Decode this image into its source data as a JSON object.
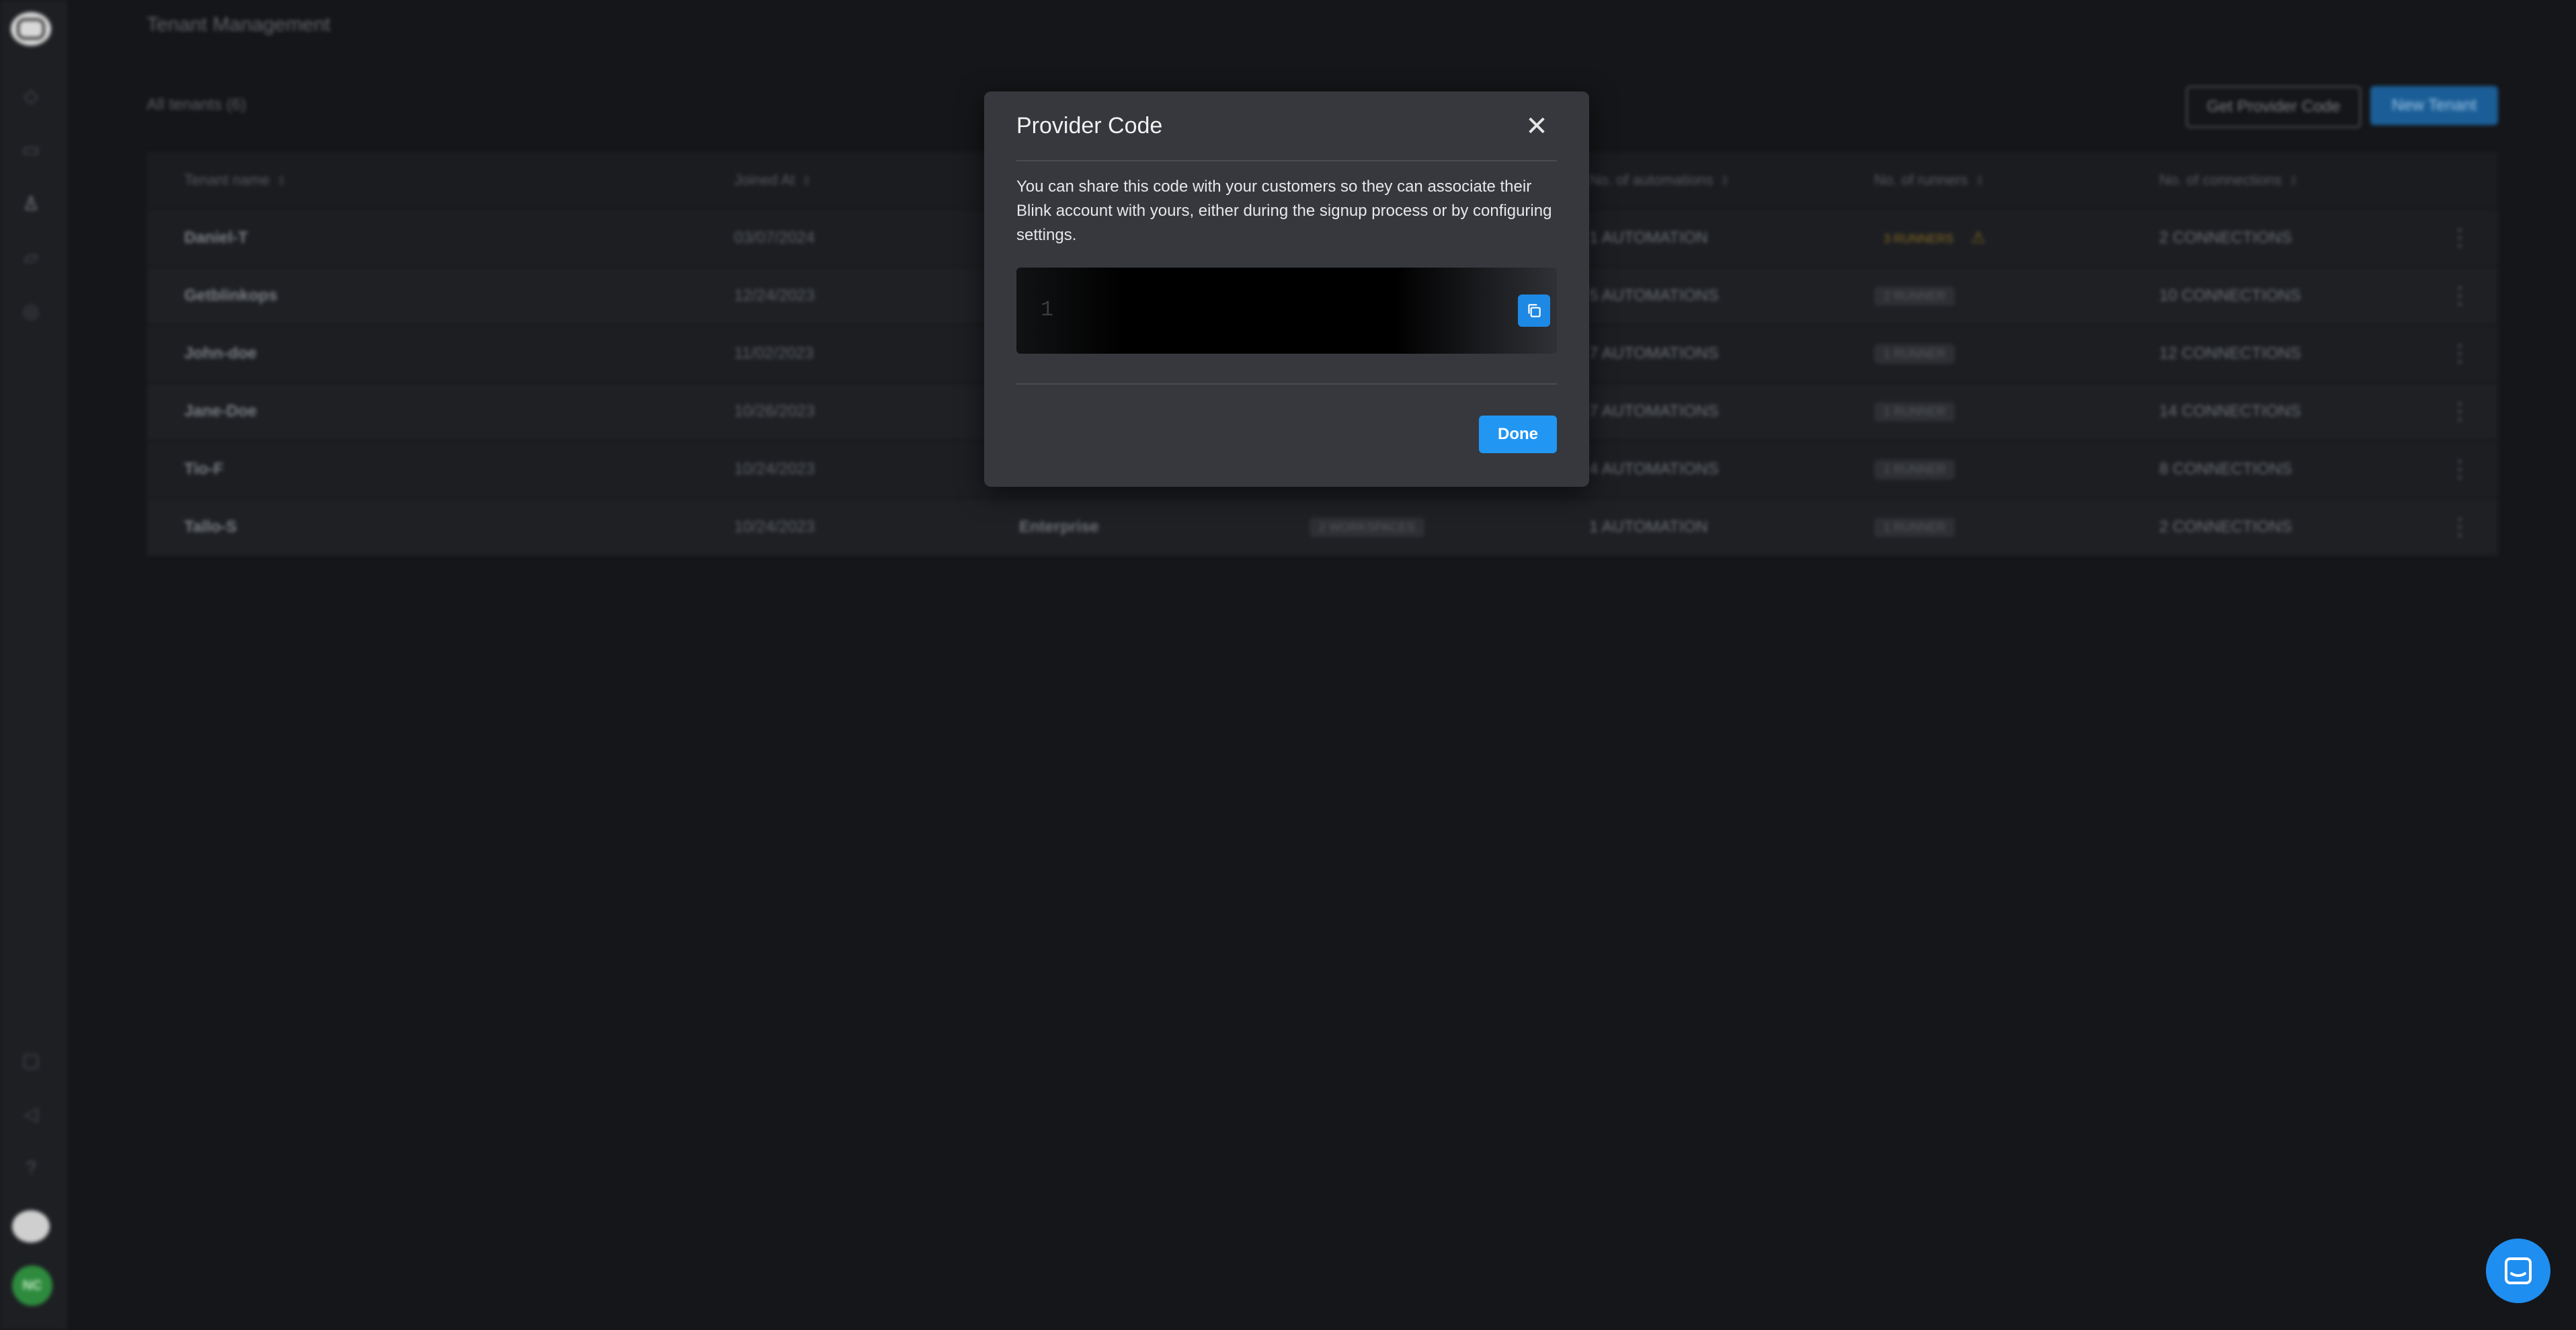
{
  "page": {
    "title": "Tenant Management",
    "count_label": "All tenants (6)",
    "get_provider_code_label": "Get Provider Code",
    "new_tenant_label": "New Tenant",
    "sidebar_avatar_initials": "NC"
  },
  "table": {
    "columns": [
      "Tenant name",
      "Joined At",
      "",
      "",
      "No. of automations",
      "No. of runners",
      "No. of connections"
    ],
    "rows": [
      {
        "name": "Daniel-T",
        "joined": "03/07/2024",
        "plan": "",
        "workspaces": "",
        "automations": "1 AUTOMATION",
        "runners": "3 RUNNERS",
        "runners_warn": true,
        "connections": "2 CONNECTIONS"
      },
      {
        "name": "Getblinkops",
        "joined": "12/24/2023",
        "plan": "",
        "workspaces": "",
        "automations": "5 AUTOMATIONS",
        "runners": "2 RUNNER",
        "runners_warn": false,
        "connections": "10 CONNECTIONS"
      },
      {
        "name": "John-doe",
        "joined": "11/02/2023",
        "plan": "",
        "workspaces": "",
        "automations": "7 AUTOMATIONS",
        "runners": "1 RUNNER",
        "runners_warn": false,
        "connections": "12 CONNECTIONS"
      },
      {
        "name": "Jane-Doe",
        "joined": "10/26/2023",
        "plan": "",
        "workspaces": "",
        "automations": "7 AUTOMATIONS",
        "runners": "1 RUNNER",
        "runners_warn": false,
        "connections": "14 CONNECTIONS"
      },
      {
        "name": "Tio-F",
        "joined": "10/24/2023",
        "plan": "",
        "workspaces": "",
        "automations": "4 AUTOMATIONS",
        "runners": "1 RUNNER",
        "runners_warn": false,
        "connections": "8 CONNECTIONS"
      },
      {
        "name": "Tallo-S",
        "joined": "10/24/2023",
        "plan": "Enterprise",
        "workspaces": "2 WORKSPACES",
        "automations": "1 AUTOMATION",
        "runners": "1 RUNNER",
        "runners_warn": false,
        "connections": "2 CONNECTIONS"
      }
    ]
  },
  "modal": {
    "title": "Provider Code",
    "description": "You can share this code with your customers so they can associate their Blink account with yours, either during the signup process or by configuring settings.",
    "code_visible": "1",
    "done_label": "Done"
  },
  "icons": {
    "close": "close-icon",
    "copy": "copy-icon",
    "chat": "chat-icon",
    "warning": "warning-icon"
  },
  "colors": {
    "accent": "#2196f3",
    "modal_bg": "#36383d",
    "page_bg": "#151619"
  }
}
